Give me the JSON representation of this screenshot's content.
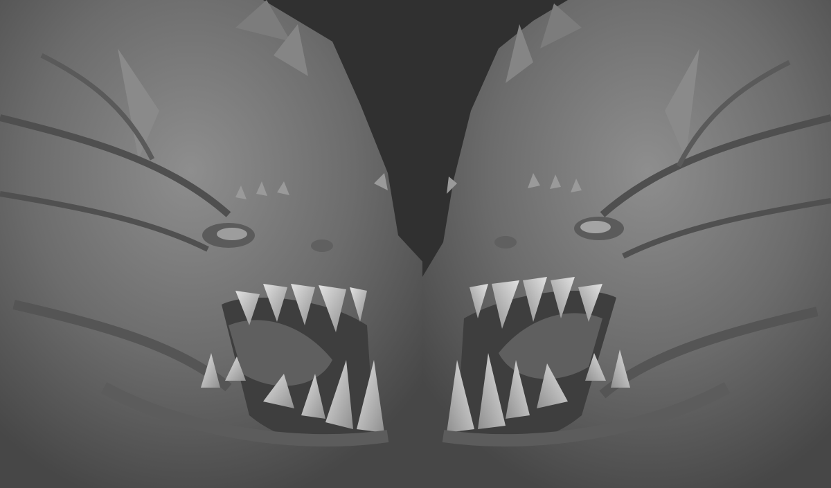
{
  "image": {
    "subject": "sculpted-creature-head",
    "views": [
      {
        "id": "view-left",
        "facing": "right"
      },
      {
        "id": "view-right",
        "facing": "left"
      }
    ],
    "colors": {
      "background": "#303030",
      "clay_dark": "#4a4a4a",
      "clay_mid": "#6f6f6f",
      "clay_light": "#9a9a9a",
      "teeth": "#c9c9c9",
      "divider": "#5a5a5a"
    }
  }
}
